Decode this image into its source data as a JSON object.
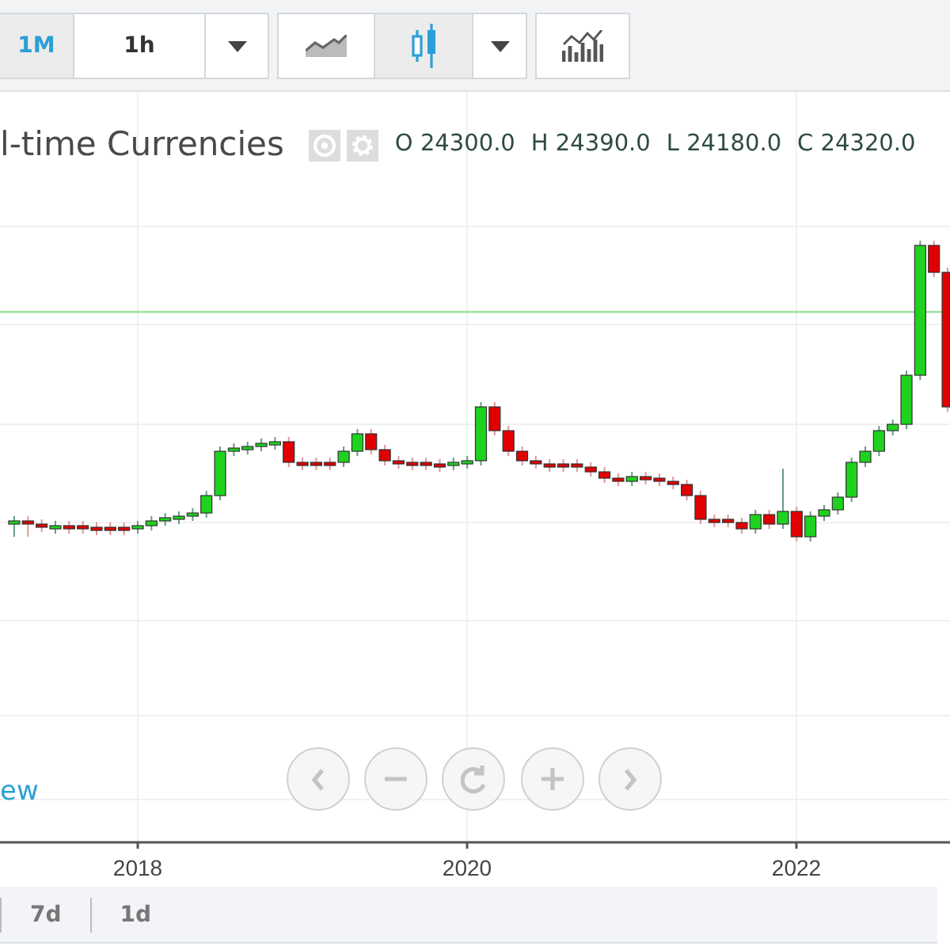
{
  "toolbar": {
    "intervals": [
      {
        "label": "1M",
        "selected": true
      },
      {
        "label": "1h",
        "selected": false
      }
    ],
    "chart_types": [
      {
        "kind": "area",
        "selected": false
      },
      {
        "kind": "candles",
        "selected": true
      }
    ]
  },
  "legend": {
    "title": "l-time Currencies",
    "values": [
      "O 24300.0",
      "H 24390.0",
      "L 24180.0",
      "C 24320.0"
    ]
  },
  "link": "ew",
  "x_axis": {
    "labels": [
      "2018",
      "2020",
      "2022"
    ]
  },
  "timeframes": [
    "7d",
    "1d"
  ]
}
